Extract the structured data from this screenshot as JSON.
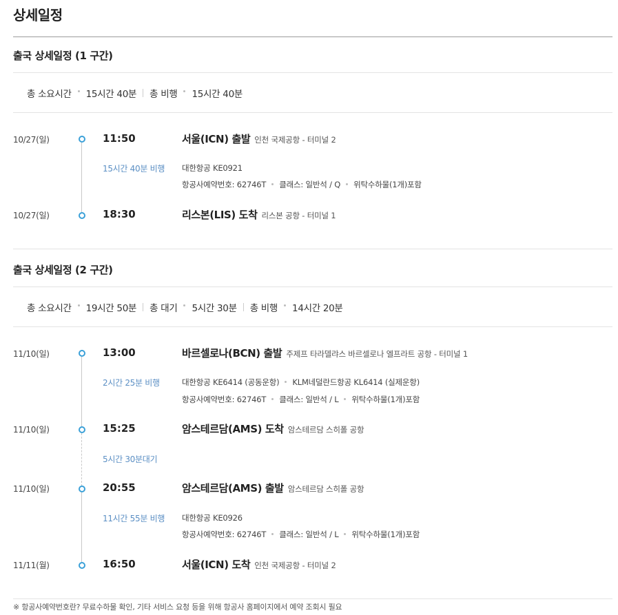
{
  "title": "상세일정",
  "sections": [
    {
      "heading": "출국 상세일정 (1 구간)",
      "summary": {
        "total_label": "총 소요시간",
        "total_value": "15시간 40분",
        "flight_label": "총 비행",
        "flight_value": "15시간 40분"
      },
      "dep": {
        "date": "10/27(일)",
        "time": "11:50",
        "place": "서울(ICN) 출발",
        "airport": "인천 국제공항 - 터미널 2"
      },
      "leg": {
        "duration": "15시간 40분 비행",
        "airline": "대한항공 KE0921",
        "booking": "항공사예약번호: 62746T",
        "class": "클래스: 일반석 / Q",
        "baggage": "위탁수하물(1개)포함"
      },
      "arr": {
        "date": "10/27(일)",
        "time": "18:30",
        "place": "리스본(LIS) 도착",
        "airport": "리스본 공항 - 터미널 1"
      }
    },
    {
      "heading": "출국 상세일정 (2 구간)",
      "summary": {
        "total_label": "총 소요시간",
        "total_value": "19시간 50분",
        "wait_label": "총 대기",
        "wait_value": "5시간 30분",
        "flight_label": "총 비행",
        "flight_value": "14시간 20분"
      },
      "dep1": {
        "date": "11/10(일)",
        "time": "13:00",
        "place": "바르셀로나(BCN) 출발",
        "airport": "주제프 타라델랴스 바르셀로나 엘프라트 공항 - 터미널 1"
      },
      "leg1": {
        "duration": "2시간 25분 비행",
        "airline": "대한항공 KE6414 (공동운항)",
        "operator": "KLM네덜란드항공 KL6414 (실제운항)",
        "booking": "항공사예약번호: 62746T",
        "class": "클래스: 일반석 / L",
        "baggage": "위탁수하물(1개)포함"
      },
      "arr1": {
        "date": "11/10(일)",
        "time": "15:25",
        "place": "암스테르담(AMS) 도착",
        "airport": "암스테르담 스히폴 공항"
      },
      "layover": "5시간 30분대기",
      "dep2": {
        "date": "11/10(일)",
        "time": "20:55",
        "place": "암스테르담(AMS) 출발",
        "airport": "암스테르담 스히폴 공항"
      },
      "leg2": {
        "duration": "11시간 55분 비행",
        "airline": "대한항공 KE0926",
        "booking": "항공사예약번호: 62746T",
        "class": "클래스: 일반석 / L",
        "baggage": "위탁수하물(1개)포함"
      },
      "arr2": {
        "date": "11/11(월)",
        "time": "16:50",
        "place": "서울(ICN) 도착",
        "airport": "인천 국제공항 - 터미널 2"
      }
    }
  ],
  "footer_note": "※  항공사예약번호란? 무료수하물 확인, 기타 서비스 요청 등을 위해 항공사 홈페이지에서 예약 조회시 필요",
  "colors": {
    "accent": "#3aa0d8",
    "duration_text": "#5b8fc4"
  }
}
